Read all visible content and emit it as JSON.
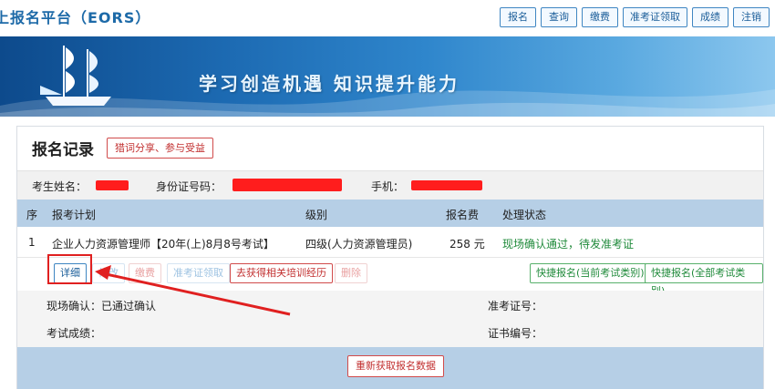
{
  "header": {
    "site_title": "上报名平台（EORS）",
    "nav": [
      "报名",
      "查询",
      "缴费",
      "准考证领取",
      "成绩",
      "注销"
    ]
  },
  "banner": {
    "slogan": "学习创造机遇  知识提升能力"
  },
  "record": {
    "title": "报名记录",
    "share_label": "猎词分享、参与受益",
    "info": {
      "name_label": "考生姓名：",
      "id_label": "身份证号码：",
      "phone_label": "手机："
    },
    "columns": [
      "序",
      "报考计划",
      "级别",
      "报名费",
      "处理状态"
    ],
    "rows": [
      {
        "index": "1",
        "plan": "企业人力资源管理师【20年(上)8月8号考试】",
        "level": "四级(人力资源管理员)",
        "fee": "258 元",
        "status": "现场确认通过，待发准考证"
      }
    ],
    "actions": {
      "detail": "详细",
      "edit": "修改",
      "pay": "缴费",
      "ticket": "准考证领取",
      "training": "去获得相关培训经历",
      "delete": "删除",
      "quick_current": "快捷报名(当前考试类别)",
      "quick_all": "快捷报名(全部考试类别)"
    },
    "detail": {
      "confirm_label": "现场确认：已通过确认",
      "ticket_label": "准考证号：",
      "score_label": "考试成绩：",
      "cert_label": "证书编号："
    },
    "refresh_label": "重新获取报名数据"
  },
  "colors": {
    "accent": "#1d6aa8",
    "danger": "#c23030",
    "success": "#1f8a3a",
    "table_header": "#b6cfe6"
  },
  "icons": [
    "ship-logo-icon",
    "annotation-arrow-icon"
  ]
}
